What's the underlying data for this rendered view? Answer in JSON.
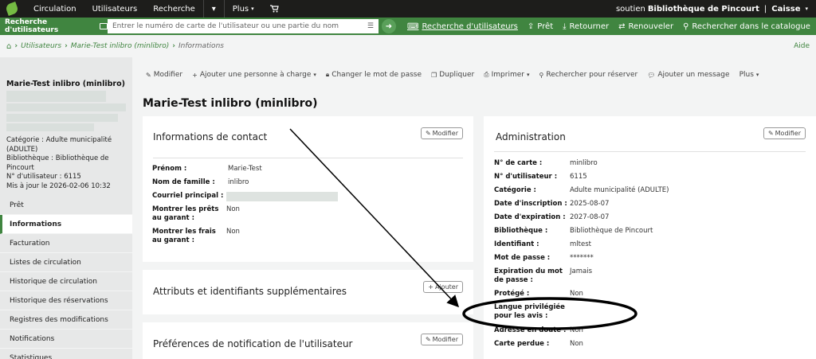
{
  "topnav": {
    "items": [
      "Circulation",
      "Utilisateurs",
      "Recherche",
      "Plus"
    ],
    "user_prefix": "soutien",
    "library": "Bibliothèque de Pincourt",
    "desk": "Caisse"
  },
  "searchbar": {
    "label": "Recherche d'utilisateurs",
    "placeholder": "Entrer le numéro de carte de l'utilisateur ou une partie du nom",
    "tools": [
      "Recherche d'utilisateurs",
      "Prêt",
      "Retourner",
      "Renouveler",
      "Rechercher dans le catalogue"
    ]
  },
  "breadcrumb": {
    "items": [
      "Utilisateurs",
      "Marie-Test inlibro (minlibro)"
    ],
    "current": "Informations",
    "help": "Aide"
  },
  "patron": {
    "name": "Marie-Test inlibro (minlibro)",
    "info": [
      "Catégorie : Adulte municipalité",
      "(ADULTE)",
      "Bibliothèque : Bibliothèque de Pincourt",
      "N° d'utilisateur : 6115",
      "Mis à jour le 2026-02-06 10:32"
    ]
  },
  "sidebar_menu": [
    "Prêt",
    "Informations",
    "Facturation",
    "Listes de circulation",
    "Historique de circulation",
    "Historique des réservations",
    "Registres des modifications",
    "Notifications",
    "Statistiques"
  ],
  "toolbar": [
    "Modifier",
    "Ajouter une personne à charge",
    "Changer le mot de passe",
    "Dupliquer",
    "Imprimer",
    "Rechercher pour réserver",
    "Ajouter un message",
    "Plus"
  ],
  "page_title": "Marie-Test inlibro (minlibro)",
  "contact": {
    "title": "Informations de contact",
    "edit": "Modifier",
    "rows": [
      {
        "label": "Prénom :",
        "value": "Marie-Test"
      },
      {
        "label": "Nom de famille :",
        "value": "inlibro"
      },
      {
        "label": "Courriel principal :",
        "value": ""
      },
      {
        "label": "Montrer les prêts au garant :",
        "value": "Non"
      },
      {
        "label": "Montrer les frais au garant :",
        "value": "Non"
      }
    ]
  },
  "attributes": {
    "title": "Attributs et identifiants supplémentaires",
    "add": "Ajouter"
  },
  "notif_prefs": {
    "title": "Préférences de notification de l'utilisateur",
    "edit": "Modifier"
  },
  "admin": {
    "title": "Administration",
    "edit": "Modifier",
    "rows": [
      {
        "label": "N° de carte :",
        "value": "minlibro"
      },
      {
        "label": "N° d'utilisateur :",
        "value": "6115"
      },
      {
        "label": "Catégorie :",
        "value": "Adulte municipalité (ADULTE)"
      },
      {
        "label": "Date d'inscription :",
        "value": "2025-08-07"
      },
      {
        "label": "Date d'expiration :",
        "value": "2027-08-07"
      },
      {
        "label": "Bibliothèque :",
        "value": "Bibliothèque de Pincourt"
      },
      {
        "label": "Identifiant :",
        "value": "mltest"
      },
      {
        "label": "Mot de passe :",
        "value": "*******"
      },
      {
        "label": "Expiration du mot de passe :",
        "value": "Jamais"
      },
      {
        "label": "Protégé :",
        "value": "Non"
      },
      {
        "label": "Langue privilégiée pour les avis :",
        "value": ""
      },
      {
        "label": "Adresse en doute :",
        "value": "Non"
      },
      {
        "label": "Carte perdue :",
        "value": "Non"
      }
    ]
  },
  "colors": {
    "brand": "#408540",
    "topbar": "#1d1d1b",
    "annotation": "#000000"
  }
}
